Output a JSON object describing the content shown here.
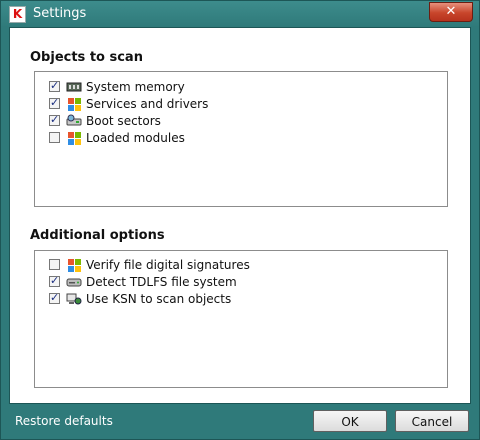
{
  "window": {
    "title": "Settings",
    "close_glyph": "✕",
    "app_icon": "K"
  },
  "objects_section": {
    "title": "Objects to scan",
    "items": [
      {
        "label": "System memory",
        "checked": true,
        "icon": "memory-icon"
      },
      {
        "label": "Services and drivers",
        "checked": true,
        "icon": "windows-flag-icon"
      },
      {
        "label": "Boot sectors",
        "checked": true,
        "icon": "disk-drive-icon"
      },
      {
        "label": "Loaded modules",
        "checked": false,
        "icon": "windows-flag-icon"
      }
    ]
  },
  "options_section": {
    "title": "Additional options",
    "items": [
      {
        "label": "Verify file digital signatures",
        "checked": false,
        "icon": "windows-flag-icon"
      },
      {
        "label": "Detect TDLFS file system",
        "checked": true,
        "icon": "hard-drive-icon"
      },
      {
        "label": "Use KSN to scan objects",
        "checked": true,
        "icon": "ksn-network-icon"
      }
    ]
  },
  "footer": {
    "restore_label": "Restore defaults",
    "ok_label": "OK",
    "cancel_label": "Cancel"
  },
  "colors": {
    "frame": "#2f7a7a",
    "accent": "#c8452b"
  }
}
